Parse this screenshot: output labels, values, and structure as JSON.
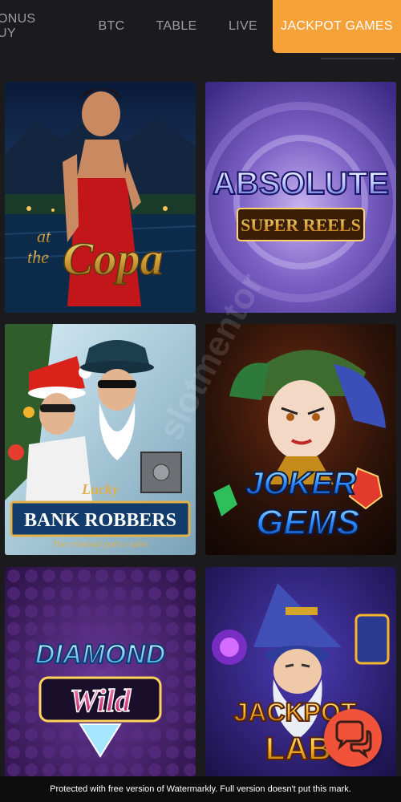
{
  "tabs": [
    {
      "label": "BONUS BUY",
      "active": false
    },
    {
      "label": "BTC",
      "active": false
    },
    {
      "label": "TABLE",
      "active": false
    },
    {
      "label": "LIVE",
      "active": false
    },
    {
      "label": "JACKPOT GAMES",
      "active": true
    }
  ],
  "games": [
    {
      "title_lines": [
        "at",
        "the",
        "Copa"
      ]
    },
    {
      "title_lines": [
        "ABSOLUTE",
        "SUPER REELS"
      ]
    },
    {
      "title_lines": [
        "Lucky",
        "BANK ROBBERS",
        "The criminal police tales"
      ]
    },
    {
      "title_lines": [
        "JOKER",
        "GEMS"
      ]
    },
    {
      "title_lines": [
        "DIAMOND",
        "Wild"
      ]
    },
    {
      "title_lines": [
        "JACKPOT",
        "LAB"
      ]
    }
  ],
  "watermark": {
    "diagonal": "slotmentor",
    "footer": "Protected with free version of Watermarkly. Full version doesn't put this mark."
  },
  "chat": {
    "icon": "chat-bubbles-icon"
  },
  "colors": {
    "accent": "#f7a139",
    "background": "#1b1b1d",
    "chat": "#f0533a"
  }
}
